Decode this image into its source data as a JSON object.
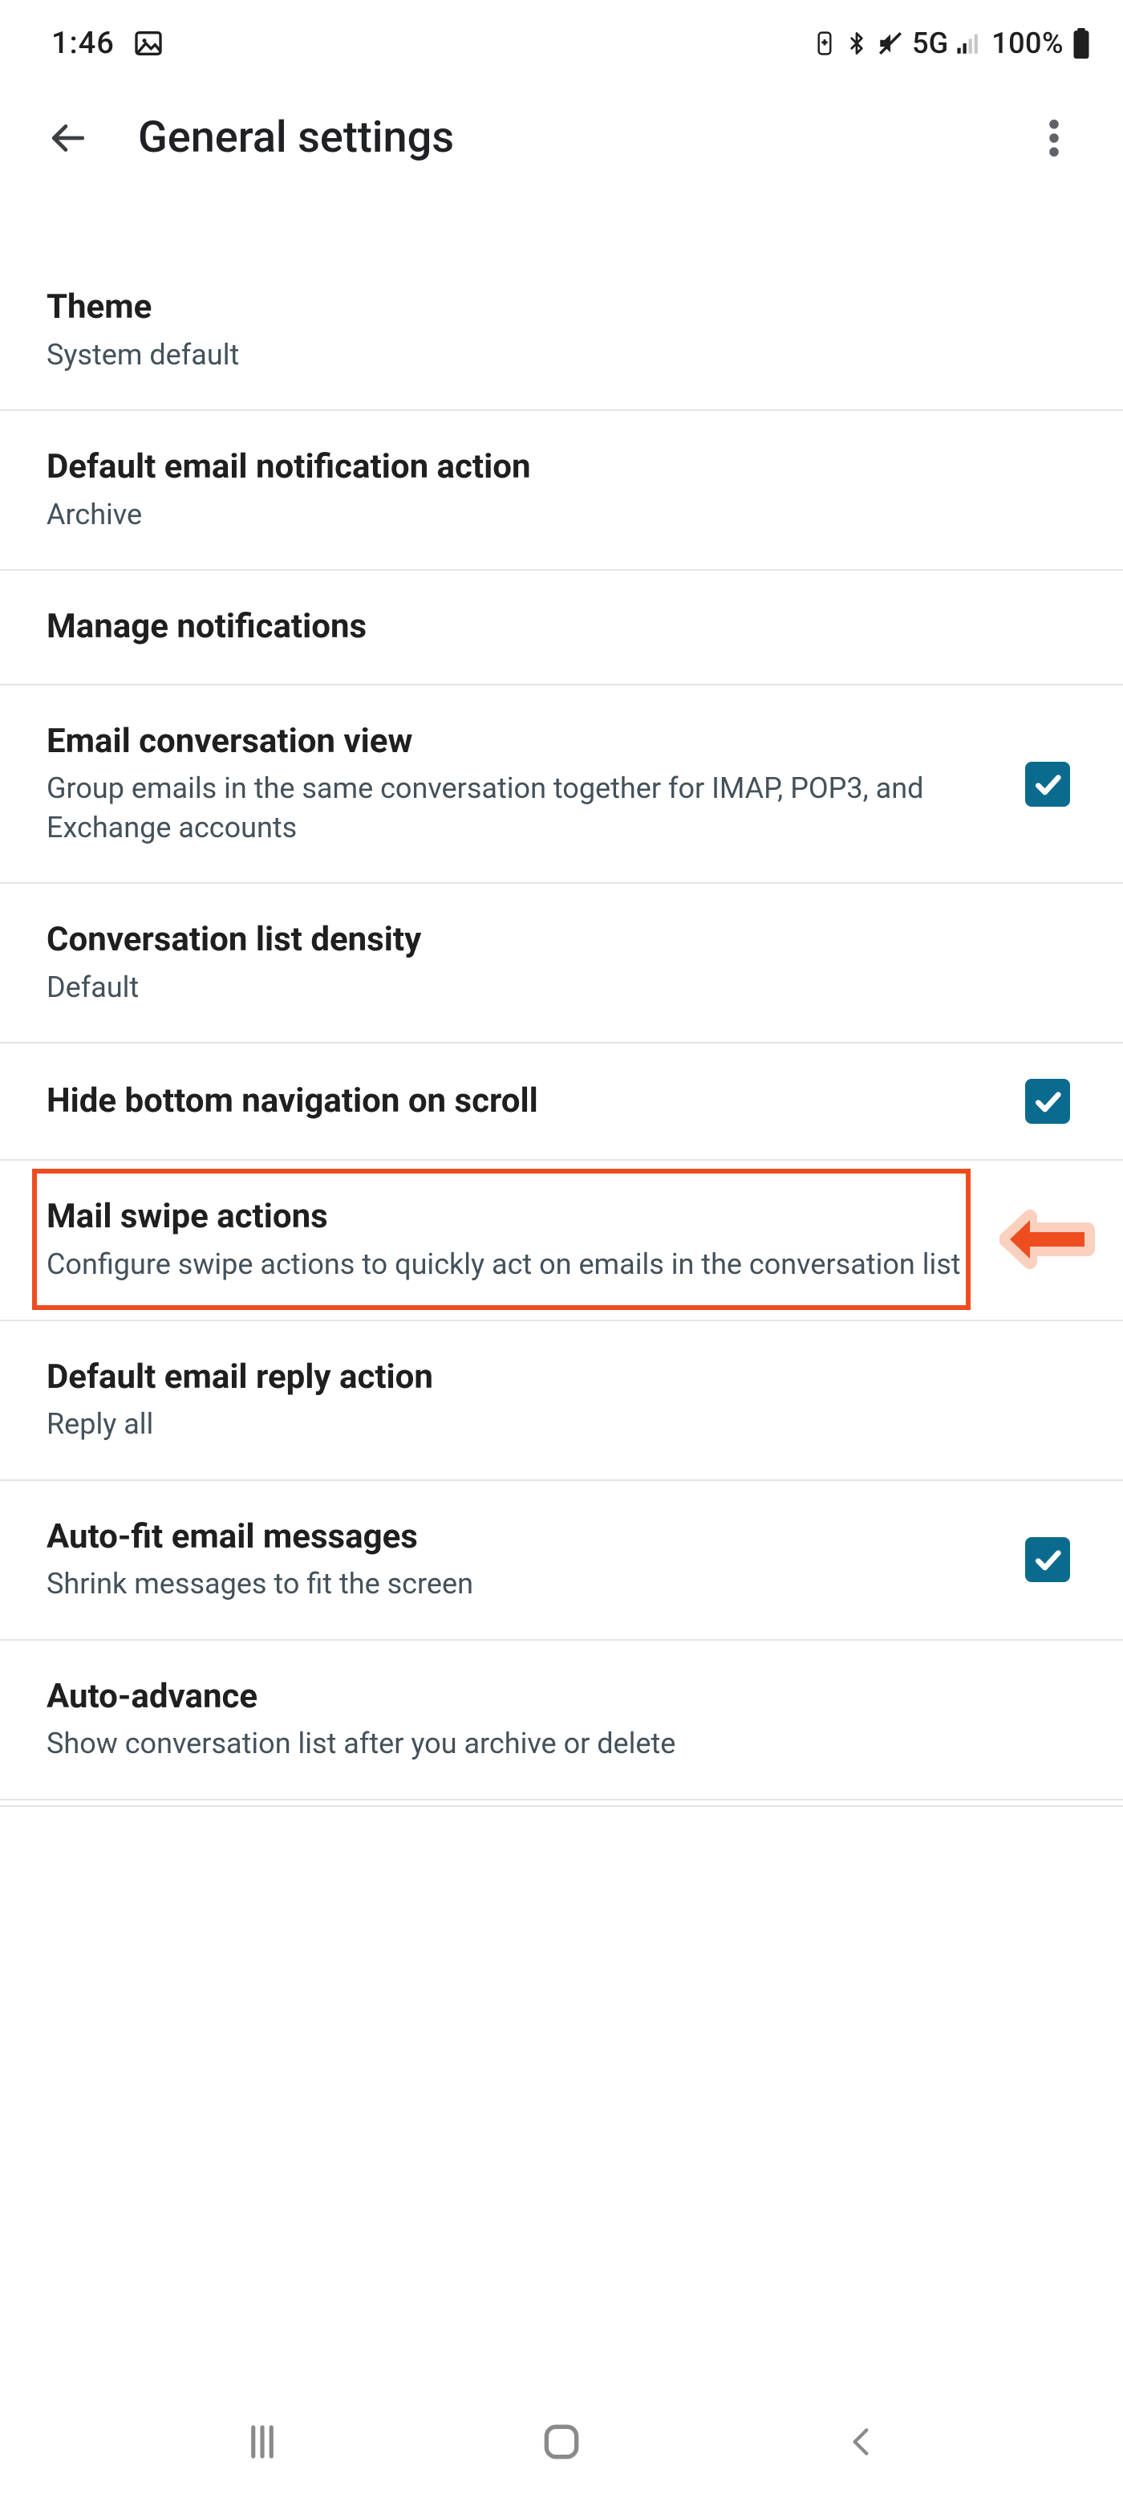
{
  "status": {
    "time": "1:46",
    "network_label": "5G",
    "battery_text": "100%"
  },
  "appbar": {
    "title": "General settings"
  },
  "settings": {
    "theme": {
      "title": "Theme",
      "sub": "System default"
    },
    "notif_action": {
      "title": "Default email notification action",
      "sub": "Archive"
    },
    "manage_notif": {
      "title": "Manage notifications"
    },
    "conv_view": {
      "title": "Email conversation view",
      "sub": "Group emails in the same conversation together for IMAP, POP3, and Exchange accounts",
      "checked": true
    },
    "density": {
      "title": "Conversation list density",
      "sub": "Default"
    },
    "hide_nav": {
      "title": "Hide bottom navigation on scroll",
      "checked": true
    },
    "swipe": {
      "title": "Mail swipe actions",
      "sub": "Configure swipe actions to quickly act on emails in the conversation list"
    },
    "reply_action": {
      "title": "Default email reply action",
      "sub": "Reply all"
    },
    "autofit": {
      "title": "Auto-fit email messages",
      "sub": "Shrink messages to fit the screen",
      "checked": true
    },
    "autoadvance": {
      "title": "Auto-advance",
      "sub": "Show conversation list after you archive or delete"
    }
  }
}
